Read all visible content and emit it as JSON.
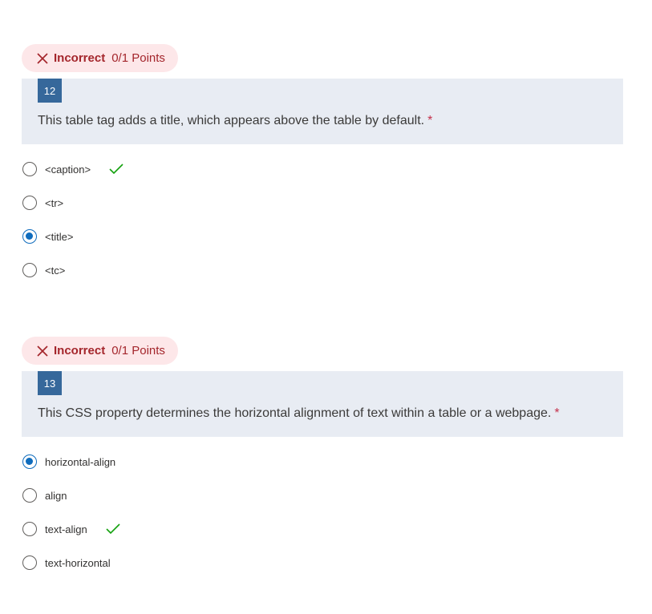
{
  "questions": [
    {
      "status": "Incorrect",
      "points": "0/1 Points",
      "number": "12",
      "text": "This table tag adds a title, which appears above the table by default.",
      "required_mark": "*",
      "options": [
        {
          "label": "<caption>",
          "selected": false,
          "correct": true
        },
        {
          "label": "<tr>",
          "selected": false,
          "correct": false
        },
        {
          "label": "<title>",
          "selected": true,
          "correct": false
        },
        {
          "label": "<tc>",
          "selected": false,
          "correct": false
        }
      ]
    },
    {
      "status": "Incorrect",
      "points": "0/1 Points",
      "number": "13",
      "text": "This CSS property determines the horizontal alignment of text within a table or a webpage.",
      "required_mark": "*",
      "options": [
        {
          "label": "horizontal-align",
          "selected": true,
          "correct": false
        },
        {
          "label": "align",
          "selected": false,
          "correct": false
        },
        {
          "label": "text-align",
          "selected": false,
          "correct": true
        },
        {
          "label": "text-horizontal",
          "selected": false,
          "correct": false
        }
      ]
    }
  ],
  "colors": {
    "incorrect": "#a4262c",
    "badge_bg": "#fde7e9",
    "question_bg": "#e8ecf3",
    "number_bg": "#36689b",
    "radio_selected": "#0f6cbd",
    "correct_check": "#13a10e",
    "required": "#c4314b"
  },
  "icons": {
    "status": "close-x-icon",
    "correct": "checkmark-icon"
  }
}
